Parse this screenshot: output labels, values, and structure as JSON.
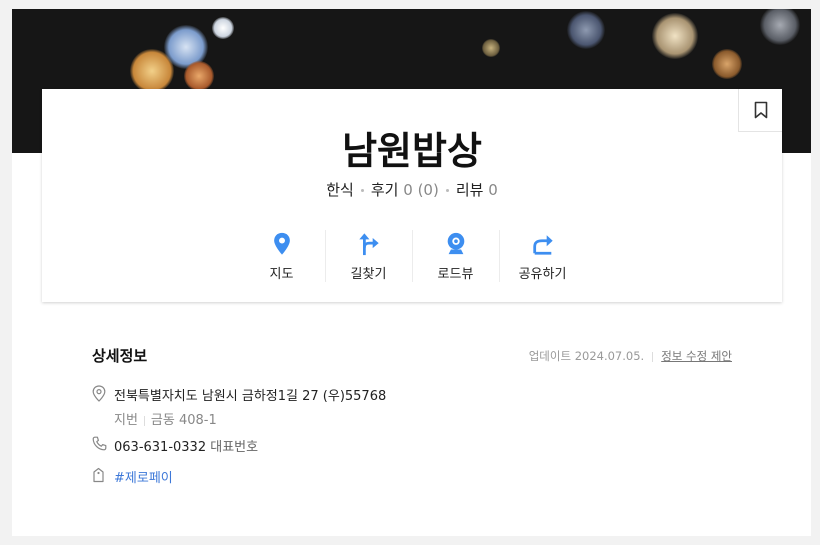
{
  "place": {
    "name": "남원밥상",
    "category": "한식",
    "review_label": "후기",
    "review_score": "0",
    "review_count": "(0)",
    "blog_label": "리뷰",
    "blog_count": "0"
  },
  "actions": [
    {
      "label": "지도",
      "icon": "map-pin-icon"
    },
    {
      "label": "길찾기",
      "icon": "directions-icon"
    },
    {
      "label": "로드뷰",
      "icon": "roadview-icon"
    },
    {
      "label": "공유하기",
      "icon": "share-icon"
    }
  ],
  "detail": {
    "title": "상세정보",
    "updated_label": "업데이트 2024.07.05.",
    "edit_link": "정보 수정 제안",
    "address": "전북특별자치도 남원시 금하정1길 27 (우)55768",
    "jibun_label": "지번",
    "jibun": "금동 408-1",
    "phone": "063-631-0332",
    "phone_tag": "대표번호",
    "hashtag": "#제로페이"
  },
  "colors": {
    "accent": "#3d8ef0",
    "link": "#3d78d8",
    "hero_bg": "#161616"
  }
}
